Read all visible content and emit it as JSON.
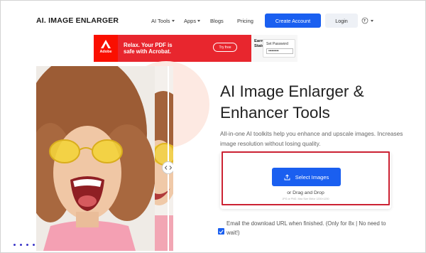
{
  "nav": {
    "logo": "AI. IMAGE ENLARGER",
    "items": [
      {
        "label": "AI Tools",
        "has_caret": true
      },
      {
        "label": "Apps",
        "has_caret": true
      },
      {
        "label": "Blogs",
        "has_caret": false
      },
      {
        "label": "Pricing",
        "has_caret": false
      }
    ],
    "create_account": "Create Account",
    "login": "Login",
    "language_icon": "translate-icon"
  },
  "ad": {
    "brand": "Adobe",
    "headline_line1": "Relax. Your PDF is",
    "headline_line2": "safe with Acrobat.",
    "cta": "Try free",
    "side_label_line1": "Earnings",
    "side_label_line2": "Statement",
    "card_title": "Set Password",
    "card_dots": "••••••••••"
  },
  "hero": {
    "title": "AI Image Enlarger & Enhancer Tools",
    "subtitle": "All-in-one AI toolkits help you enhance and upscale images. Increases image resolution without losing quality."
  },
  "upload": {
    "button_label": "Select Images",
    "drag_text": "or Drag and Drop",
    "format_note": "JPG or PNG. Max Size 5M/or 1200×1200",
    "email_note": "Email the download URL when finished. (Only for 8x | No need to wait!)",
    "checkbox_checked": true
  },
  "colors": {
    "primary": "#1a5ff0",
    "highlight_border": "#cc2233",
    "ad_red": "#e8262e"
  }
}
